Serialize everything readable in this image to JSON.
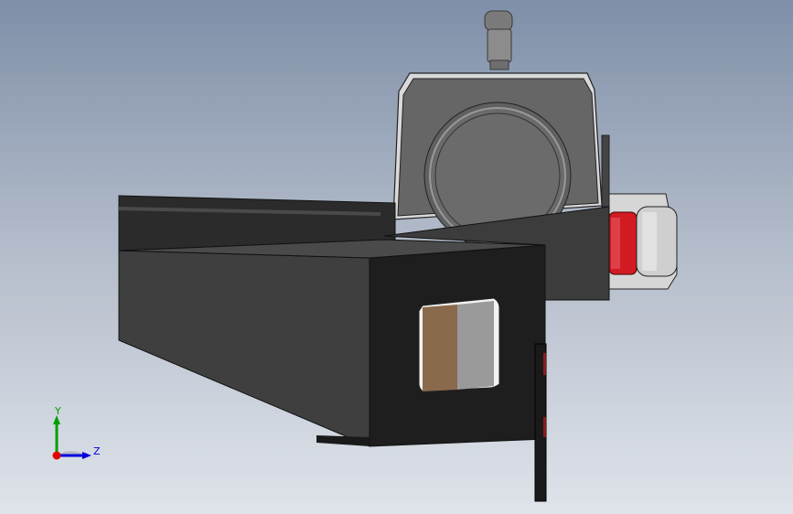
{
  "viewport": {
    "background_top": "#7f8fa8",
    "background_bottom": "#dfe3ea"
  },
  "model": {
    "part_colors": {
      "housing_dark": "#3a3a3a",
      "housing_side": "#2a2a2a",
      "motor_cover": "#6a6a6a",
      "flange_red": "#d11a22",
      "roller_silver": "#c9c9c9",
      "window_brown": "#8a6a4c",
      "window_gray": "#9a9a9a"
    }
  },
  "triad": {
    "y_label": "Y",
    "z_label": "Z",
    "x_color": "#e00000",
    "y_color": "#00a000",
    "z_color": "#0000e0"
  }
}
